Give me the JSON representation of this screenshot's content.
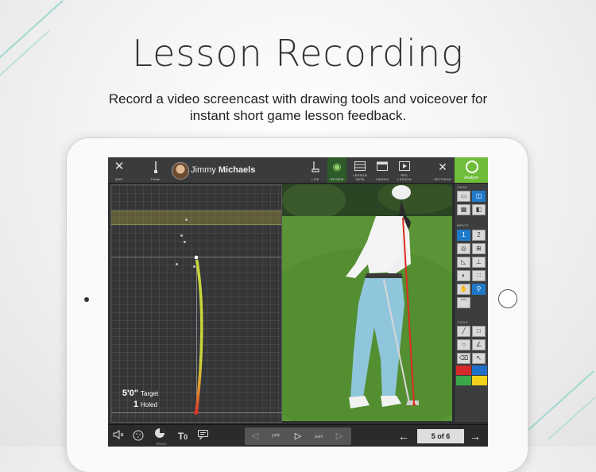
{
  "headline": "Lesson Recording",
  "subline": "Record a video screencast with drawing tools and voiceover for instant short game lesson feedback.",
  "app": {
    "topbar": {
      "quit": "QUIT",
      "club": "Putter",
      "user_first": "Jimmy",
      "user_last": "Michaels",
      "live": "LIVE",
      "review": "REVIEW",
      "lesson_data": "LESSON DATA",
      "videos": "VIDEOS",
      "rec_lesson": "REC LESSON",
      "settings": "SETTINGS",
      "analyze": "Analyze"
    },
    "sidebar": {
      "view_label": "VIEWS",
      "inputs_label": "INPUTS",
      "tools_label": "TOOLS",
      "swatches": [
        "#d42a2a",
        "#1f6fc9",
        "#3aa84a",
        "#f2d21b"
      ]
    },
    "stats": {
      "distance_value": "5'0\"",
      "distance_label": "Target",
      "holed_value": "1",
      "holed_label": "Holed"
    },
    "bottombar": {
      "speed_label": "SPEED",
      "text_tool": "T",
      "text_count": "0",
      "page_indicator": "5 of 6"
    },
    "colors": {
      "accent": "#6fbd3a",
      "active_tool": "#1f7ac9",
      "putt_line_start": "#e33224",
      "putt_line_end": "#c8d63a"
    }
  }
}
